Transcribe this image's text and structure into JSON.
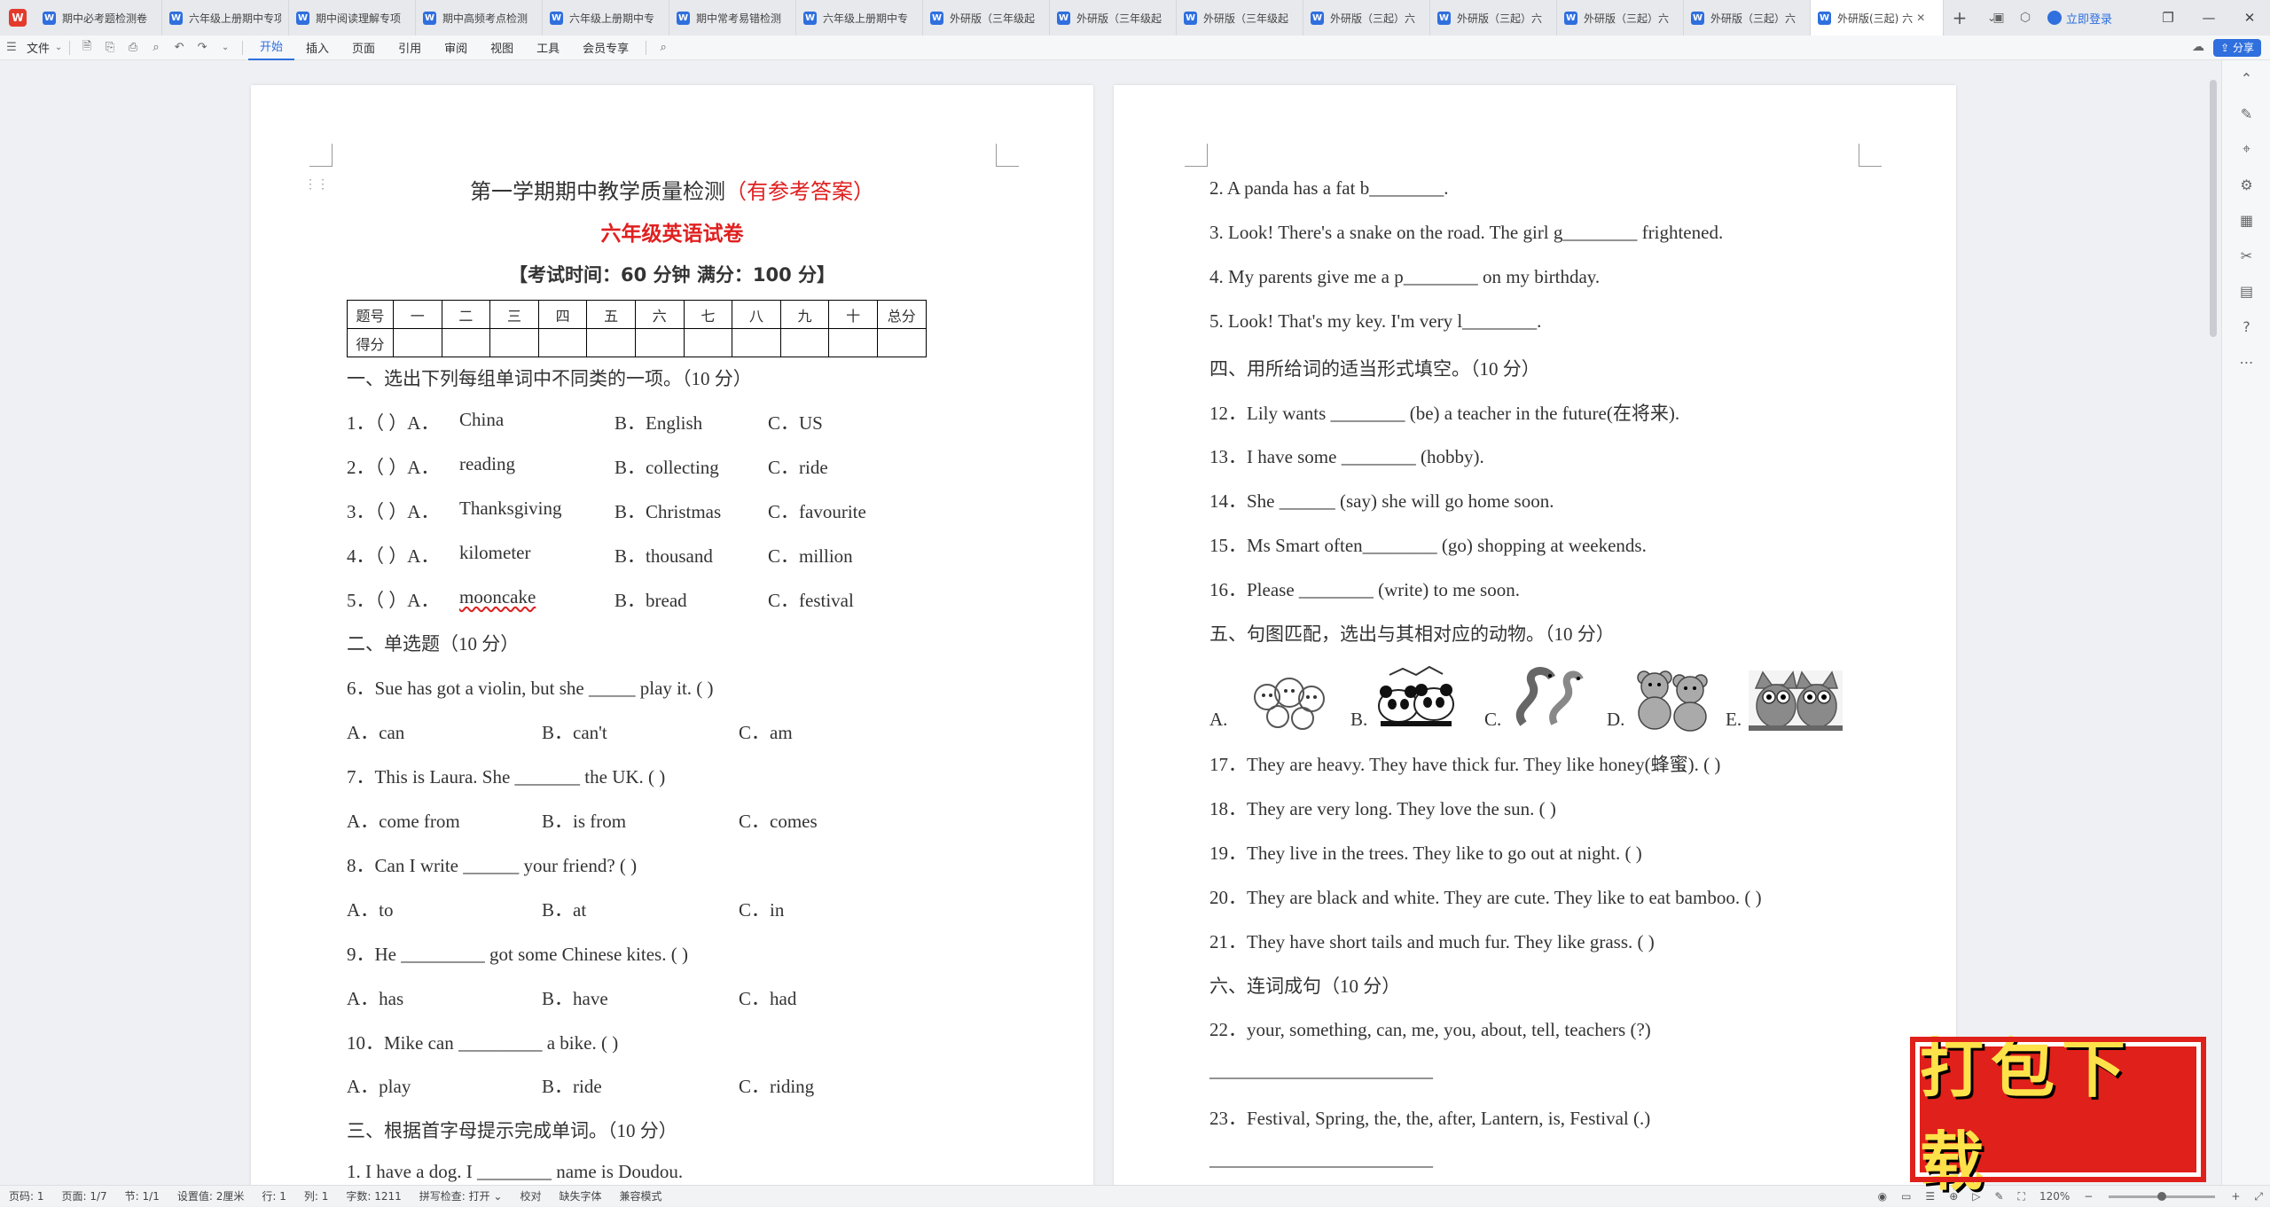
{
  "tabs": [
    {
      "label": "期中必考题检测卷"
    },
    {
      "label": "六年级上册期中专项"
    },
    {
      "label": "期中阅读理解专项"
    },
    {
      "label": "期中高频考点检测"
    },
    {
      "label": "六年级上册期中专"
    },
    {
      "label": "期中常考易错检测"
    },
    {
      "label": "六年级上册期中专"
    },
    {
      "label": "外研版（三年级起"
    },
    {
      "label": "外研版（三年级起"
    },
    {
      "label": "外研版（三年级起"
    },
    {
      "label": "外研版（三起）六"
    },
    {
      "label": "外研版（三起）六"
    },
    {
      "label": "外研版（三起）六"
    },
    {
      "label": "外研版（三起）六"
    },
    {
      "label": "外研版(三起) 六"
    }
  ],
  "header": {
    "login": "立即登录"
  },
  "toolbar": {
    "file": "文件",
    "menus": [
      "开始",
      "插入",
      "页面",
      "引用",
      "审阅",
      "视图",
      "工具",
      "会员专享"
    ],
    "share": "分享"
  },
  "page1": {
    "title_black": "第一学期期中教学质量检测",
    "title_red": "（有参考答案）",
    "subtitle": "六年级英语试卷",
    "exam_info": "【考试时间：60 分钟  满分：100 分】",
    "score_table": {
      "row1": [
        "题号",
        "一",
        "二",
        "三",
        "四",
        "五",
        "六",
        "七",
        "八",
        "九",
        "十",
        "总分"
      ],
      "row2_label": "得分"
    },
    "lines": [
      {
        "t": "一、选出下列每组单词中不同类的一项。（10 分）"
      },
      {
        "n": "1．（  ）A．",
        "a": "China",
        "b": "B．English",
        "c": "C．US"
      },
      {
        "n": "2．（  ）A．",
        "a": "reading",
        "b": "B．collecting",
        "c": "C．ride"
      },
      {
        "n": "3．（  ）A．",
        "a": "Thanksgiving",
        "b": "B．Christmas",
        "c": "C．favourite"
      },
      {
        "n": "4．（  ）A．",
        "a": "kilometer",
        "b": "B．thousand",
        "c": "C．million"
      },
      {
        "n": "5．（  ）A．",
        "a": "mooncake",
        "b": "B．bread",
        "c": "C．festival"
      },
      {
        "t": "二、单选题（10 分）"
      },
      {
        "t": "6．Sue has got a violin, but she _____ play it. (    )"
      },
      {
        "a": "A．can",
        "b": "B．can't",
        "c": "C．am"
      },
      {
        "t": "7．This is Laura. She _______ the UK. ( )"
      },
      {
        "a": "A．come from",
        "b": "B．is from",
        "c": "C．comes"
      },
      {
        "t": "8．Can I write ______ your friend? ( )"
      },
      {
        "a": "A．to",
        "b": "B．at",
        "c": "C．in"
      },
      {
        "t": "9．He _________ got some Chinese kites. (      )"
      },
      {
        "a": "A．has",
        "b": "B．have",
        "c": "C．had"
      },
      {
        "t": "10．Mike can _________ a bike. (      )"
      },
      {
        "a": "A．play",
        "b": "B．ride",
        "c": "C．riding"
      },
      {
        "t": "三、根据首字母提示完成单词。（10 分）"
      },
      {
        "t": "1. I have a dog. I ________ name is Doudou."
      }
    ]
  },
  "page2": {
    "lines": [
      {
        "t": "2. A panda has a fat b________."
      },
      {
        "t": "3. Look! There's a snake on the road. The girl g________ frightened."
      },
      {
        "t": "4. My parents give me a p________ on my birthday."
      },
      {
        "t": "5. Look! That's my key. I'm very l________."
      },
      {
        "t": "四、用所给词的适当形式填空。（10 分）"
      },
      {
        "t": "12．Lily wants  ________ (be) a teacher in the future(在将来)."
      },
      {
        "t": "13．I have some ________ (hobby)."
      },
      {
        "t": "14．She ______ (say) she will go home soon."
      },
      {
        "t": "15．Ms Smart often________ (go) shopping at weekends."
      },
      {
        "t": "16．Please ________ (write) to me soon."
      },
      {
        "t": "五、句图匹配，选出与其相对应的动物。（10 分）"
      }
    ],
    "pic_labels": [
      "A.",
      "B.",
      "C.",
      "D.",
      "E."
    ],
    "lines2": [
      {
        "t": "17．They are heavy. They have thick fur. They like honey(蜂蜜). (       )"
      },
      {
        "t": "18．They are very long. They love the sun. (       )"
      },
      {
        "t": "19．They live in the trees. They like to go out at night. (       )"
      },
      {
        "t": "20．They are black and white. They are cute. They like to eat bamboo. (       )"
      },
      {
        "t": "21．They have short tails and much fur. They like grass. (       )"
      },
      {
        "t": "六、连词成句（10 分）"
      },
      {
        "t": "22．your, something, can, me, you, about, tell, teachers (?)"
      },
      {
        "t": "________________________"
      },
      {
        "t": "23．Festival, Spring, the, the, after, Lantern, is, Festival (.)"
      },
      {
        "t": "________________________"
      }
    ]
  },
  "status": {
    "items": [
      "页码: 1",
      "页面: 1/7",
      "节: 1/1",
      "设置值: 2厘米",
      "行: 1",
      "列: 1",
      "字数: 1211",
      "拼写检查: 打开 ⌄",
      "校对",
      "缺失字体",
      "兼容模式"
    ],
    "zoom": "120%"
  },
  "banner": "打包下载"
}
